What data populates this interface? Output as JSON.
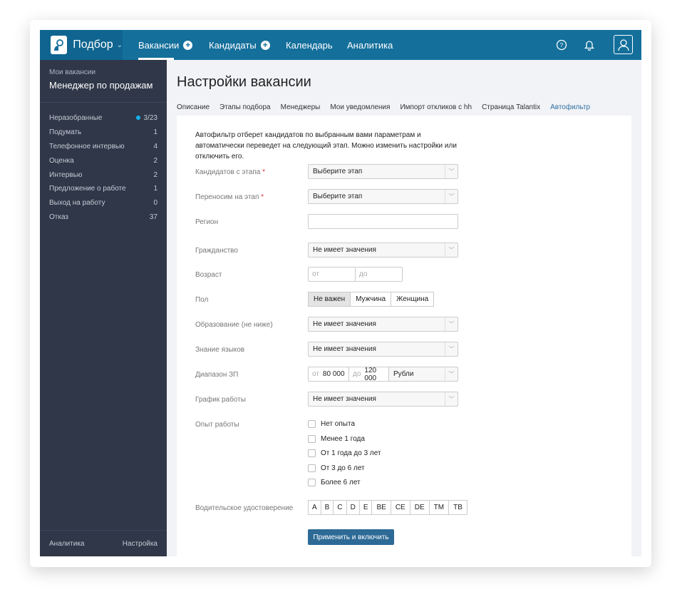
{
  "header": {
    "brand": "Подбор",
    "nav": [
      {
        "label": "Вакансии",
        "plus": true
      },
      {
        "label": "Кандидаты",
        "plus": true
      },
      {
        "label": "Календарь"
      },
      {
        "label": "Аналитика"
      }
    ]
  },
  "sidebar": {
    "caption": "Мои вакансии",
    "vacancy": "Менеджер по продажам",
    "items": [
      {
        "label": "Неразобранные",
        "count": "3/23"
      },
      {
        "label": "Подумать",
        "count": "1"
      },
      {
        "label": "Телефонное интервью",
        "count": "4"
      },
      {
        "label": "Оценка",
        "count": "2"
      },
      {
        "label": "Интервью",
        "count": "2"
      },
      {
        "label": "Предложение о работе",
        "count": "1"
      },
      {
        "label": "Выход на работу",
        "count": "0"
      },
      {
        "label": "Отказ",
        "count": "37"
      }
    ],
    "footer_left": "Аналитика",
    "footer_right": "Настройка"
  },
  "page": {
    "title": "Настройки вакансии",
    "tabs": [
      "Описание",
      "Этапы подбора",
      "Менеджеры",
      "Мои уведомления",
      "Импорт откликов с hh",
      "Страница Talantix",
      "Автофильтр"
    ]
  },
  "form": {
    "intro": "Автофильтр отберет кандидатов по выбранным вами параметрам и автоматически переведет на следующий этап. Можно изменить настройки или отключить его.",
    "from_stage": {
      "label": "Кандидатов с этапа",
      "value": "Выберите этап"
    },
    "to_stage": {
      "label": "Переносим на этап",
      "value": "Выберите этап"
    },
    "region": {
      "label": "Регион",
      "value": ""
    },
    "citizenship": {
      "label": "Гражданство",
      "value": "Не имеет значения"
    },
    "age": {
      "label": "Возраст",
      "from_ph": "от",
      "to_ph": "до"
    },
    "gender": {
      "label": "Пол",
      "options": [
        "Не важен",
        "Мужчина",
        "Женщина"
      ],
      "selected": "Не важен"
    },
    "education": {
      "label": "Образование (не ниже)",
      "value": "Не имеет значения"
    },
    "languages": {
      "label": "Знание языков",
      "value": "Не имеет значения"
    },
    "salary": {
      "label": "Диапазон ЗП",
      "from_ph": "от",
      "from": "80 000",
      "to_ph": "до",
      "to": "120 000",
      "currency": "Рубли"
    },
    "schedule": {
      "label": "График работы",
      "value": "Не имеет значения"
    },
    "experience": {
      "label": "Опыт работы",
      "options": [
        "Нет опыта",
        "Менее 1 года",
        "От 1 года до 3 лет",
        "От 3 до 6 лет",
        "Более 6 лет"
      ]
    },
    "license": {
      "label": "Водительское удостоверение",
      "options": [
        "A",
        "B",
        "C",
        "D",
        "E",
        "BE",
        "CE",
        "DE",
        "TM",
        "TB"
      ]
    },
    "submit": "Применить и включить"
  }
}
